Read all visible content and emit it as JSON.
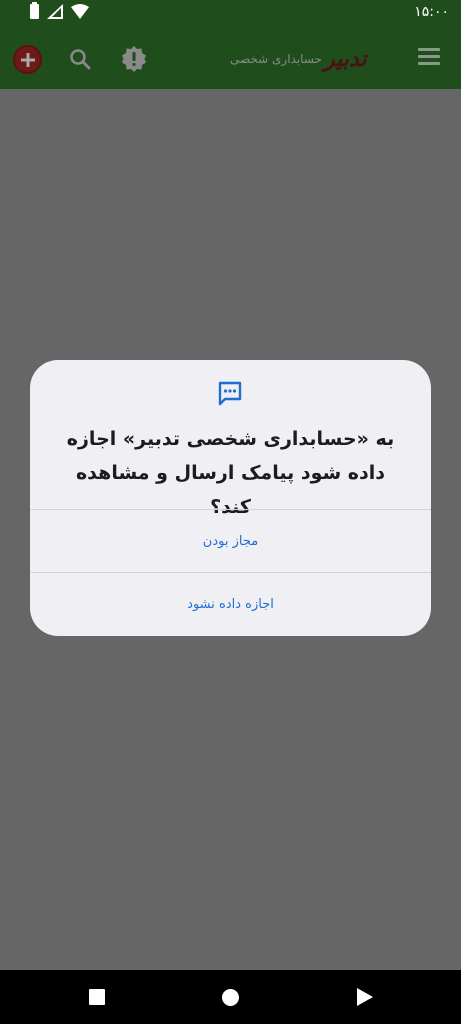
{
  "status_bar": {
    "time": "۱۵:۰۰",
    "icons": [
      "battery-icon",
      "signal-icon",
      "wifi-icon"
    ]
  },
  "app_bar": {
    "brand_logo": "تدبیر",
    "brand_subtitle": "حسابداری شخصی",
    "icons": [
      "add-icon",
      "search-icon",
      "alert-icon",
      "menu-icon"
    ],
    "colors": {
      "background": "#1f4d1c",
      "add_button": "#6e1a18"
    }
  },
  "dialog": {
    "icon": "sms-icon",
    "message": "به «حسابداری شخصی تدبیر» اجازه داده شود پیامک ارسال و مشاهده کند؟",
    "allow_label": "مجاز بودن",
    "deny_label": "اجازه داده نشود",
    "colors": {
      "accent": "#1f6fd1",
      "background": "#efeff4"
    }
  },
  "nav_bar": {
    "icons": [
      "back-square-icon",
      "home-circle-icon",
      "recent-triangle-icon"
    ]
  }
}
